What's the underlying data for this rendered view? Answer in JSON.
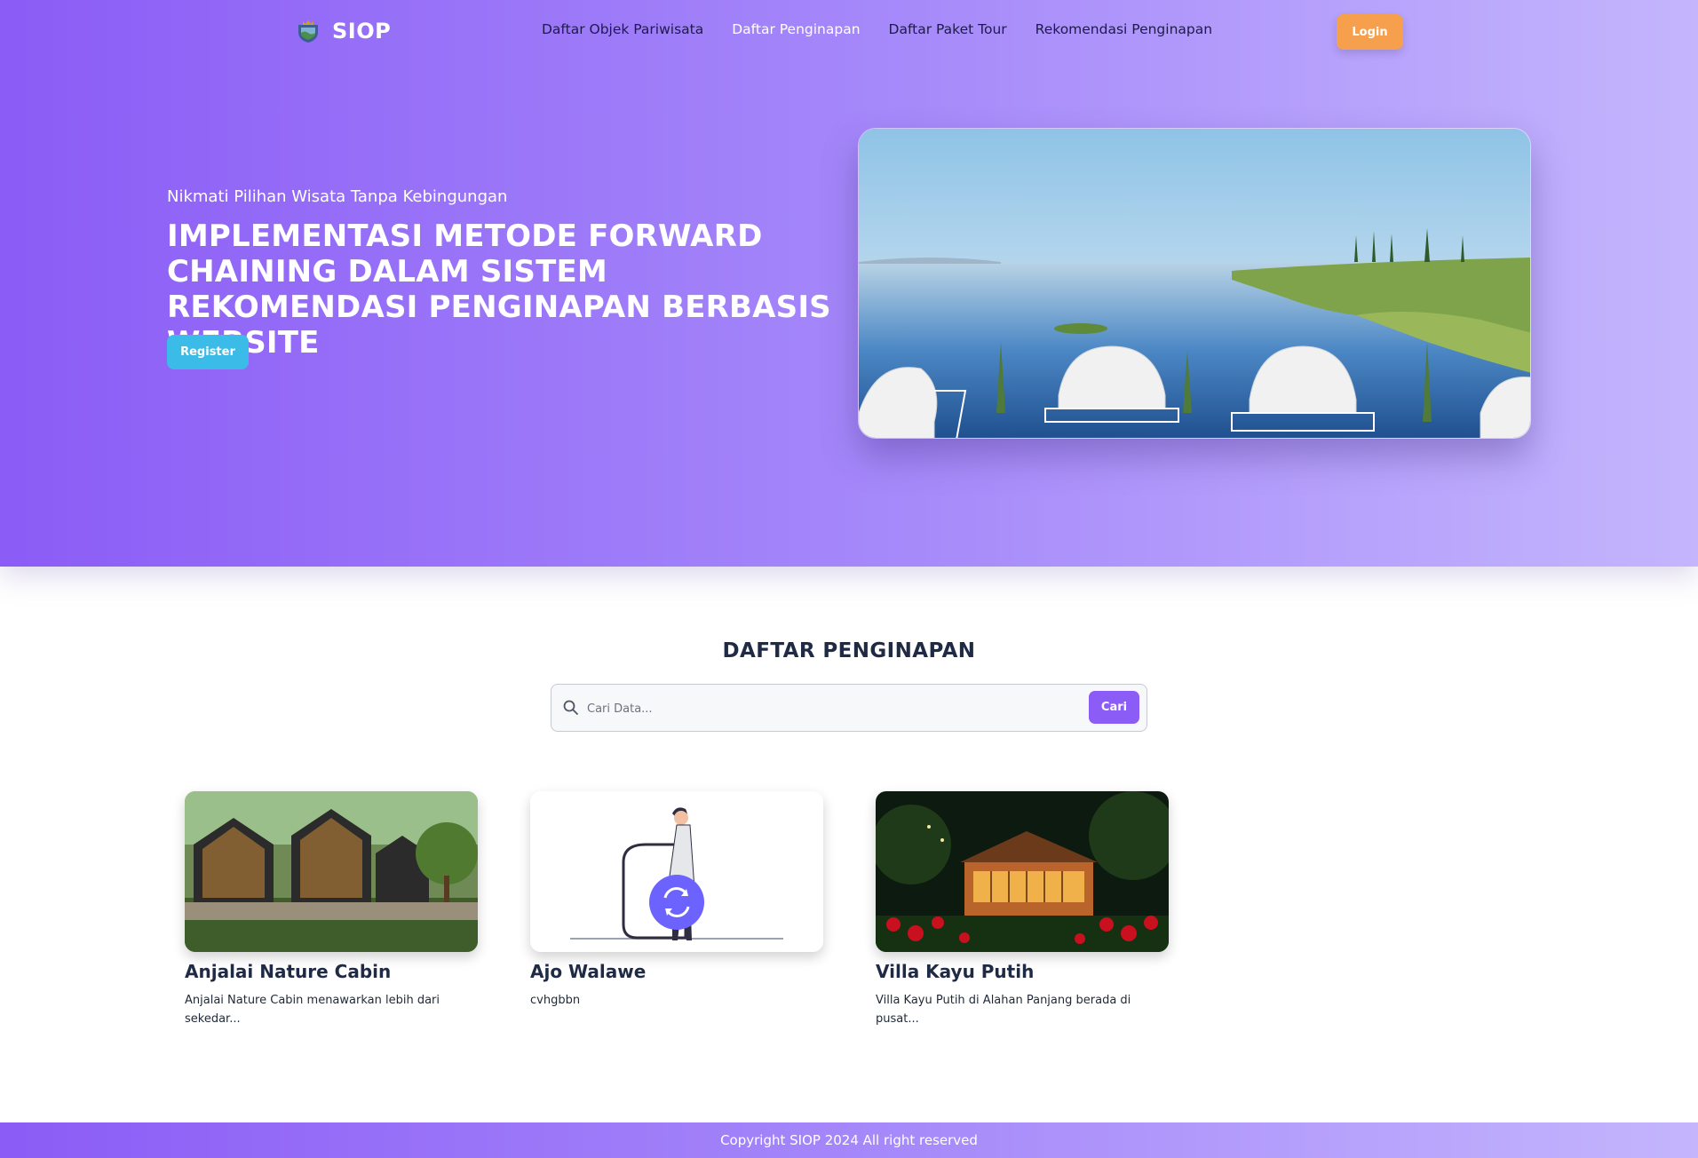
{
  "nav": {
    "brand": "SIOP",
    "links": [
      {
        "label": "Daftar Objek Pariwisata",
        "active": false
      },
      {
        "label": "Daftar Penginapan",
        "active": true
      },
      {
        "label": "Daftar Paket Tour",
        "active": false
      },
      {
        "label": "Rekomendasi Penginapan",
        "active": false
      }
    ],
    "login_label": "Login"
  },
  "hero": {
    "subtitle": "Nikmati Pilihan Wisata Tanpa Kebingungan",
    "title": "IMPLEMENTASI METODE FORWARD CHAINING DALAM SISTEM REKOMENDASI PENGINAPAN BERBASIS WEBSITE",
    "register_label": "Register"
  },
  "listing": {
    "title": "DAFTAR PENGINAPAN",
    "search": {
      "placeholder": "Cari Data...",
      "value": "",
      "button_label": "Cari"
    },
    "cards": [
      {
        "title": "Anjalai Nature Cabin",
        "description": "Anjalai Nature Cabin menawarkan lebih dari sekedar..."
      },
      {
        "title": "Ajo Walawe",
        "description": "cvhgbbn"
      },
      {
        "title": "Villa Kayu Putih",
        "description": "Villa Kayu Putih di Alahan Panjang berada di pusat..."
      }
    ]
  },
  "footer": {
    "text": "Copyright SIOP 2024 All right reserved"
  },
  "colors": {
    "primary": "#8b5cf6",
    "login": "#f6a04d",
    "register": "#3bbce8"
  }
}
